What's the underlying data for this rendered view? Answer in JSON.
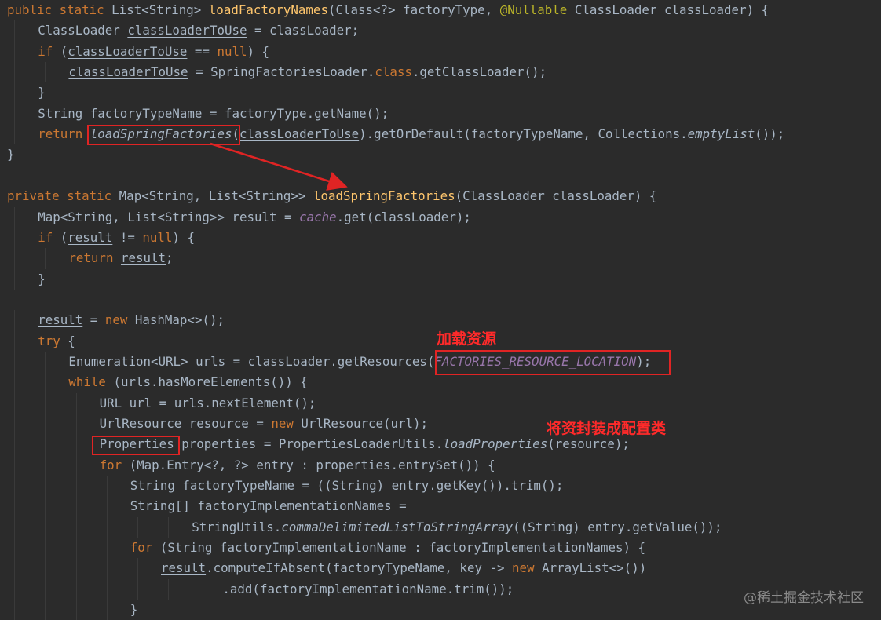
{
  "code_lines": [
    {
      "indent": 0,
      "tokens": [
        {
          "t": "public static ",
          "c": "kw"
        },
        {
          "t": "List<String> "
        },
        {
          "t": "loadFactoryNames",
          "c": "fn"
        },
        {
          "t": "(Class<?> factoryType, "
        },
        {
          "t": "@Nullable",
          "c": "an"
        },
        {
          "t": " ClassLoader classLoader) {"
        }
      ]
    },
    {
      "indent": 1,
      "tokens": [
        {
          "t": "ClassLoader "
        },
        {
          "t": "classLoaderToUse",
          "c": "u"
        },
        {
          "t": " = classLoader;"
        }
      ]
    },
    {
      "indent": 1,
      "tokens": [
        {
          "t": "if ",
          "c": "kw"
        },
        {
          "t": "("
        },
        {
          "t": "classLoaderToUse",
          "c": "u"
        },
        {
          "t": " == "
        },
        {
          "t": "null",
          "c": "kw"
        },
        {
          "t": ") {"
        }
      ]
    },
    {
      "indent": 2,
      "tokens": [
        {
          "t": "classLoaderToUse",
          "c": "u"
        },
        {
          "t": " = SpringFactoriesLoader."
        },
        {
          "t": "class",
          "c": "kw"
        },
        {
          "t": ".getClassLoader();"
        }
      ]
    },
    {
      "indent": 1,
      "tokens": [
        {
          "t": "}"
        }
      ]
    },
    {
      "indent": 1,
      "tokens": [
        {
          "t": "String factoryTypeName = factoryType.getName();"
        }
      ]
    },
    {
      "indent": 1,
      "tokens": [
        {
          "t": "return ",
          "c": "kw"
        },
        {
          "t": "loadSpringFactories",
          "c": "si"
        },
        {
          "t": "("
        },
        {
          "t": "classLoaderToUse",
          "c": "u"
        },
        {
          "t": ").getOrDefault(factoryTypeName, Collections."
        },
        {
          "t": "emptyList",
          "c": "s"
        },
        {
          "t": "());"
        }
      ]
    },
    {
      "indent": 0,
      "tokens": [
        {
          "t": "}"
        }
      ]
    },
    {
      "indent": 0,
      "tokens": []
    },
    {
      "indent": 0,
      "tokens": [
        {
          "t": "private static ",
          "c": "kw"
        },
        {
          "t": "Map<String, List<String>> "
        },
        {
          "t": "loadSpringFactories",
          "c": "fn"
        },
        {
          "t": "(ClassLoader classLoader) {"
        }
      ]
    },
    {
      "indent": 1,
      "tokens": [
        {
          "t": "Map<String, List<String>> "
        },
        {
          "t": "result",
          "c": "u"
        },
        {
          "t": " = "
        },
        {
          "t": "cache",
          "c": "field"
        },
        {
          "t": ".get(classLoader);"
        }
      ]
    },
    {
      "indent": 1,
      "tokens": [
        {
          "t": "if ",
          "c": "kw"
        },
        {
          "t": "("
        },
        {
          "t": "result",
          "c": "u"
        },
        {
          "t": " != "
        },
        {
          "t": "null",
          "c": "kw"
        },
        {
          "t": ") {"
        }
      ]
    },
    {
      "indent": 2,
      "tokens": [
        {
          "t": "return ",
          "c": "kw"
        },
        {
          "t": "result",
          "c": "u"
        },
        {
          "t": ";"
        }
      ]
    },
    {
      "indent": 1,
      "tokens": [
        {
          "t": "}"
        }
      ]
    },
    {
      "indent": 0,
      "tokens": []
    },
    {
      "indent": 1,
      "tokens": [
        {
          "t": "result",
          "c": "u"
        },
        {
          "t": " = "
        },
        {
          "t": "new ",
          "c": "kw"
        },
        {
          "t": "HashMap<>();"
        }
      ]
    },
    {
      "indent": 1,
      "tokens": [
        {
          "t": "try ",
          "c": "kw"
        },
        {
          "t": "{"
        }
      ]
    },
    {
      "indent": 2,
      "tokens": [
        {
          "t": "Enumeration<URL> urls = classLoader.getResources("
        },
        {
          "t": "FACTORIES_RESOURCE_LOCATION",
          "c": "field"
        },
        {
          "t": ");"
        }
      ]
    },
    {
      "indent": 2,
      "tokens": [
        {
          "t": "while ",
          "c": "kw"
        },
        {
          "t": "(urls.hasMoreElements()) {"
        }
      ]
    },
    {
      "indent": 3,
      "tokens": [
        {
          "t": "URL url = urls.nextElement();"
        }
      ]
    },
    {
      "indent": 3,
      "tokens": [
        {
          "t": "UrlResource resource = "
        },
        {
          "t": "new ",
          "c": "kw"
        },
        {
          "t": "UrlResource(url);"
        }
      ]
    },
    {
      "indent": 3,
      "tokens": [
        {
          "t": "Properties properties = PropertiesLoaderUtils."
        },
        {
          "t": "loadProperties",
          "c": "s"
        },
        {
          "t": "(resource);"
        }
      ]
    },
    {
      "indent": 3,
      "tokens": [
        {
          "t": "for ",
          "c": "kw"
        },
        {
          "t": "(Map.Entry<?, ?> entry : properties.entrySet()) {"
        }
      ]
    },
    {
      "indent": 4,
      "tokens": [
        {
          "t": "String factoryTypeName = ((String) entry.getKey()).trim();"
        }
      ]
    },
    {
      "indent": 4,
      "tokens": [
        {
          "t": "String[] factoryImplementationNames ="
        }
      ]
    },
    {
      "indent": 6,
      "tokens": [
        {
          "t": "StringUtils."
        },
        {
          "t": "commaDelimitedListToStringArray",
          "c": "s"
        },
        {
          "t": "((String) entry.getValue());"
        }
      ]
    },
    {
      "indent": 4,
      "tokens": [
        {
          "t": "for ",
          "c": "kw"
        },
        {
          "t": "(String factoryImplementationName : factoryImplementationNames) {"
        }
      ]
    },
    {
      "indent": 5,
      "tokens": [
        {
          "t": "result",
          "c": "u"
        },
        {
          "t": ".computeIfAbsent(factoryTypeName, key -> "
        },
        {
          "t": "new ",
          "c": "kw"
        },
        {
          "t": "ArrayList<>())"
        }
      ]
    },
    {
      "indent": 7,
      "tokens": [
        {
          "t": ".add(factoryImplementationName.trim());"
        }
      ]
    },
    {
      "indent": 4,
      "tokens": [
        {
          "t": "}"
        }
      ]
    }
  ],
  "annotations": {
    "load_resources": "加载资源",
    "wrap_properties": "将资封装成配置类"
  },
  "watermark": "@稀土掘金技术社区",
  "colors": {
    "background": "#2b2b2b",
    "plain": "#a9b7c6",
    "keyword": "#cc7832",
    "method_decl": "#ffc66d",
    "annotation": "#bbb529",
    "static_field": "#9876aa",
    "highlight_box": "#e02424"
  }
}
